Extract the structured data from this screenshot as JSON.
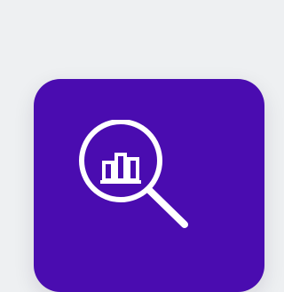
{
  "app_tile": {
    "icon": "search-analytics-icon",
    "background_color": "#4a0cb0",
    "icon_color": "#ffffff",
    "page_background_color": "#eef0f2"
  }
}
